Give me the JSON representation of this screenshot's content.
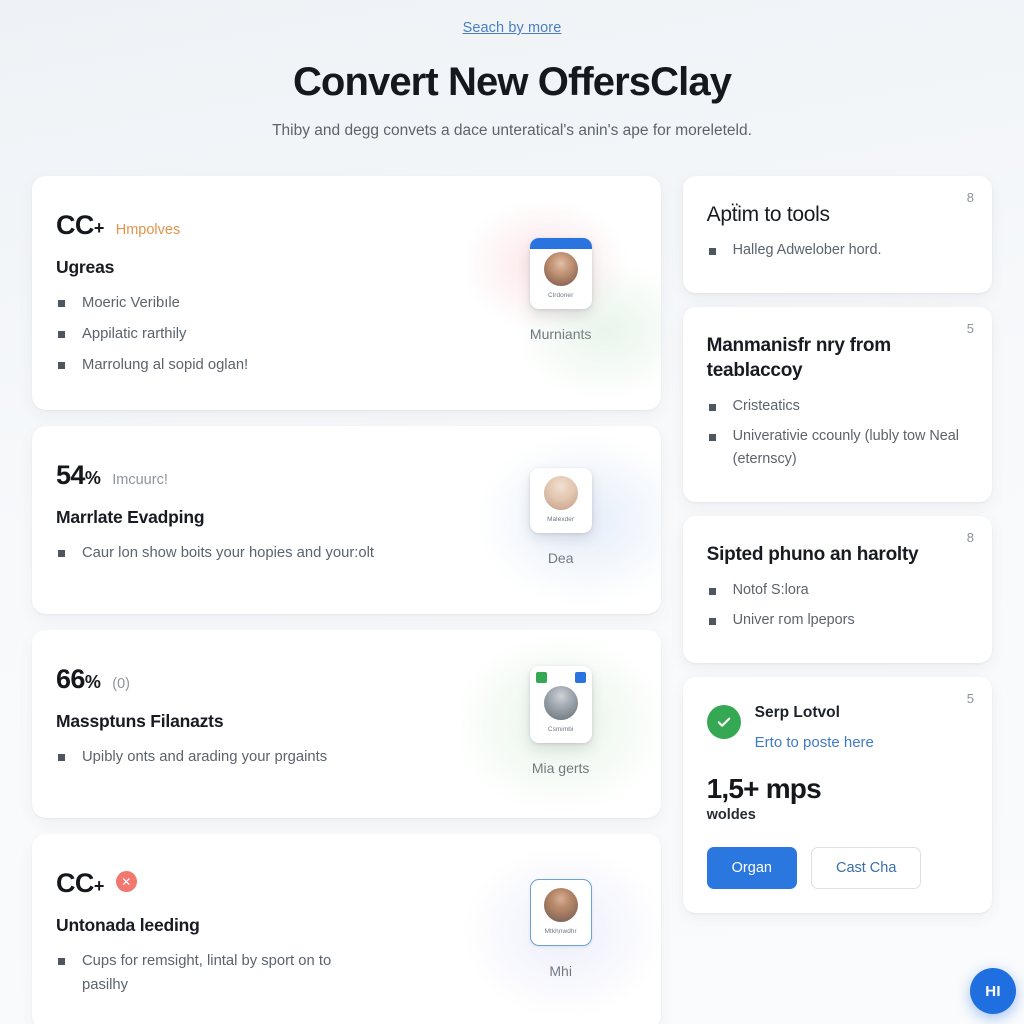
{
  "hero": {
    "eyebrow": "Seach by more",
    "title": "Convert New OffersClay",
    "subtitle": "Thiby and degg convets a dace unteratical's anin's ape for moreleteld."
  },
  "left_cards": [
    {
      "metric": "CC",
      "metric_unit": "+",
      "metric_note": "Hmpolves",
      "note_style": "accent",
      "heading": "Ugreas",
      "bullets": [
        "Moeric Veribıle",
        "Appilatic rarthily",
        "Marrolung al sopid oglan!"
      ],
      "media": {
        "mini_name": "Clrdoner",
        "caption": "Murniants",
        "style": "with-bar"
      }
    },
    {
      "metric": "54",
      "metric_unit": "%",
      "metric_note": "Imcuurc!",
      "note_style": "muted",
      "heading": "Marrlate Evadping",
      "bullets": [
        "Caur lon show boits your hopies and your:olt"
      ],
      "media": {
        "mini_name": "Malexder",
        "caption": "Dea",
        "style": "plain"
      }
    },
    {
      "metric": "66",
      "metric_unit": "%",
      "metric_note": "(0)",
      "note_style": "muted",
      "heading": "Massptuns Filanazts",
      "bullets": [
        "Upibly onts and arading your prgaints"
      ],
      "media": {
        "mini_name": "Csmimbi",
        "caption": "Mia gerts",
        "style": "chips"
      }
    },
    {
      "metric": "CC",
      "metric_unit": "+",
      "metric_note": "",
      "note_style": "badge-x",
      "badge_glyph": "✕",
      "heading": "Untonada leeding",
      "bullets": [
        "Cups for remsight, lintal by sport on to pasilhy"
      ],
      "media": {
        "mini_name": "Mtkhnwdhr",
        "caption": "Mhi",
        "style": "outlined"
      }
    }
  ],
  "right_cards": [
    {
      "number": "8",
      "heading": "Apẗim to tools",
      "style": "plain",
      "bullets": [
        "Halleg Adwelober hord."
      ]
    },
    {
      "number": "5",
      "heading": "Manmanisfr nry from teablaccoy",
      "style": "bold",
      "bullets": [
        "Cristeatics",
        "Univerativie ccounly (lubly tow Neal (eternscy)"
      ]
    },
    {
      "number": "8",
      "heading": "Sipted phuno an harolty",
      "style": "bold",
      "bullets": [
        "Notof S:lora",
        "Univer гom lpepors"
      ]
    }
  ],
  "promo": {
    "number": "5",
    "title": "Serp Lotvol",
    "link": "Erto to poste here",
    "big_value": "1,5+ mps",
    "small_value": "woldes",
    "primary_button": "Organ",
    "secondary_button": "Cast Cha"
  },
  "fab": {
    "label": "HI"
  },
  "colors": {
    "accent_blue": "#2b77e0",
    "link_blue": "#3f7bc4",
    "eyebrow_blue": "#4a7fc1",
    "orange": "#e0944a",
    "red": "#f2776f",
    "green": "#34a853",
    "page_bg": "#f2f5f8",
    "card_bg": "#ffffff"
  }
}
